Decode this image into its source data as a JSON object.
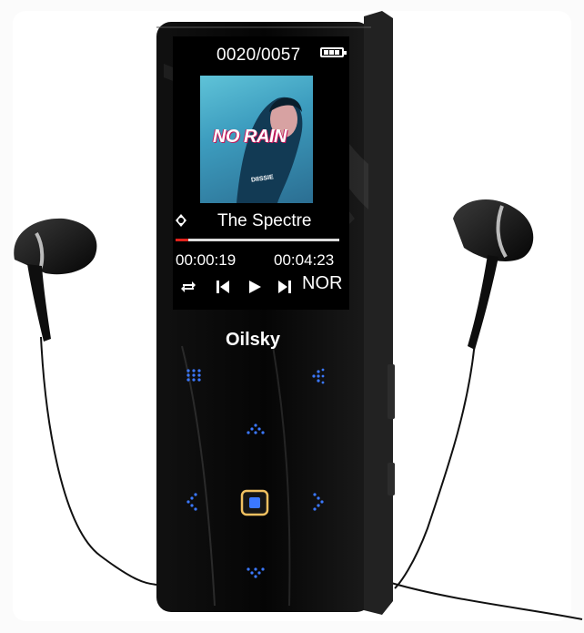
{
  "player": {
    "brand": "Oilsky",
    "track_counter": "0020/0057",
    "battery_icon": "battery-full-icon",
    "album_art_title": "NO RAIN",
    "album_art_small_text": "DIISSIE",
    "song_title": "The Spectre",
    "elapsed_time": "00:00:19",
    "total_time": "00:04:23",
    "progress": 0.08,
    "play_mode": "NOR",
    "screen_controls": [
      "repeat-icon",
      "previous-track-icon",
      "play-icon",
      "next-track-icon"
    ],
    "touch_buttons": [
      "menu-grid-icon",
      "back-icon",
      "volume-up-icon",
      "left-icon",
      "center-select-icon",
      "right-icon",
      "volume-down-icon"
    ]
  },
  "colors": {
    "body": "#0d0d0d",
    "touch_led": "#3b78ff",
    "center_button_ring": "#f0c060",
    "progress_bar": "#e0231c"
  }
}
